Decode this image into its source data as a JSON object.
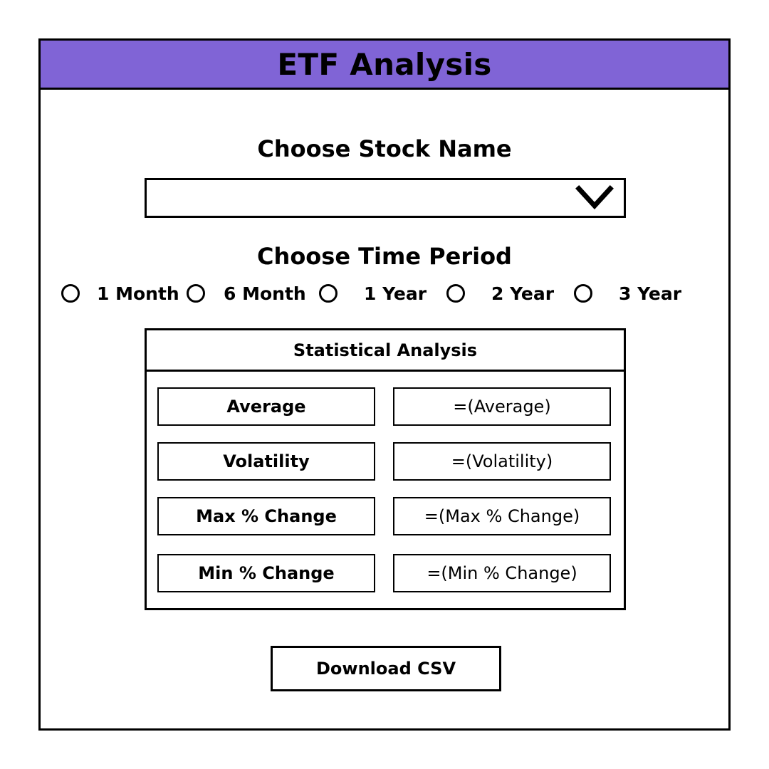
{
  "app": {
    "title": "ETF Analysis"
  },
  "stock": {
    "heading": "Choose Stock Name",
    "selected_value": "",
    "icon": "chevron-down-icon"
  },
  "period": {
    "heading": "Choose Time Period",
    "options": [
      {
        "label": "1 Month",
        "selected": false
      },
      {
        "label": "6 Month",
        "selected": false
      },
      {
        "label": "1 Year",
        "selected": false
      },
      {
        "label": "2 Year",
        "selected": false
      },
      {
        "label": "3 Year",
        "selected": false
      }
    ]
  },
  "stats": {
    "title": "Statistical Analysis",
    "rows": [
      {
        "label": "Average",
        "value": "=(Average)"
      },
      {
        "label": "Volatility",
        "value": "=(Volatility)"
      },
      {
        "label": "Max % Change",
        "value": "=(Max % Change)"
      },
      {
        "label": "Min % Change",
        "value": "=(Min % Change)"
      }
    ]
  },
  "actions": {
    "download_label": "Download CSV"
  },
  "colors": {
    "title_bar": "#8064d6",
    "border": "#000000",
    "background": "#ffffff"
  }
}
